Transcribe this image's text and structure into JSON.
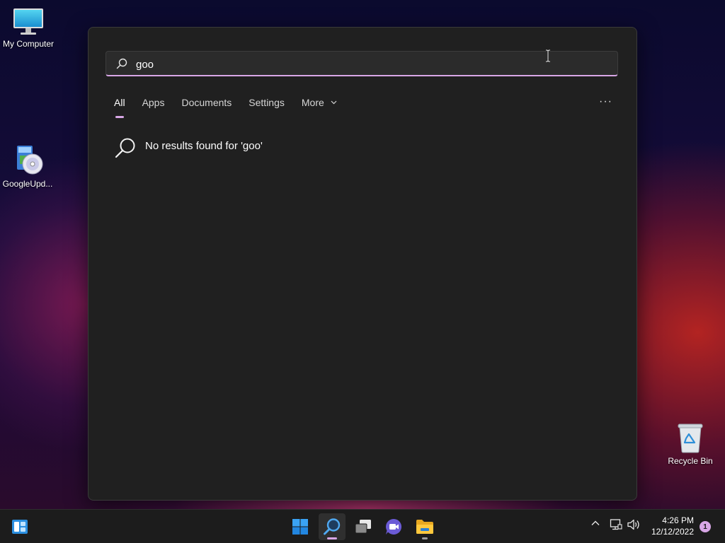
{
  "desktop": {
    "icons": [
      {
        "label": "My Computer",
        "icon": "computer-icon"
      },
      {
        "label": "GoogleUpd...",
        "icon": "installer-disc-icon"
      },
      {
        "label": "Recycle Bin",
        "icon": "recycle-bin-icon"
      }
    ]
  },
  "search": {
    "query": "goo",
    "icon": "search-icon",
    "tabs": [
      {
        "label": "All",
        "active": true
      },
      {
        "label": "Apps"
      },
      {
        "label": "Documents"
      },
      {
        "label": "Settings"
      },
      {
        "label": "More"
      }
    ],
    "more_icon": "chevron-down-icon",
    "options_glyph": "···",
    "no_results_text": "No results found for 'goo'"
  },
  "taskbar": {
    "items": [
      {
        "name": "widgets-button",
        "icon": "widgets-icon"
      },
      {
        "name": "start-button",
        "icon": "windows-logo-icon"
      },
      {
        "name": "search-button",
        "icon": "search-icon",
        "active": true
      },
      {
        "name": "task-view-button",
        "icon": "task-view-icon"
      },
      {
        "name": "chat-button",
        "icon": "chat-camera-icon"
      },
      {
        "name": "file-explorer-button",
        "icon": "folder-icon"
      }
    ],
    "tray": {
      "icons": [
        "chevron-up-icon",
        "network-icon",
        "volume-icon"
      ],
      "time": "4:26 PM",
      "date": "12/12/2022",
      "notification_count": "1"
    }
  },
  "colors": {
    "accent": "#d8a7e6",
    "panel_bg": "#202020",
    "taskbar_bg": "#1c1c1c"
  }
}
